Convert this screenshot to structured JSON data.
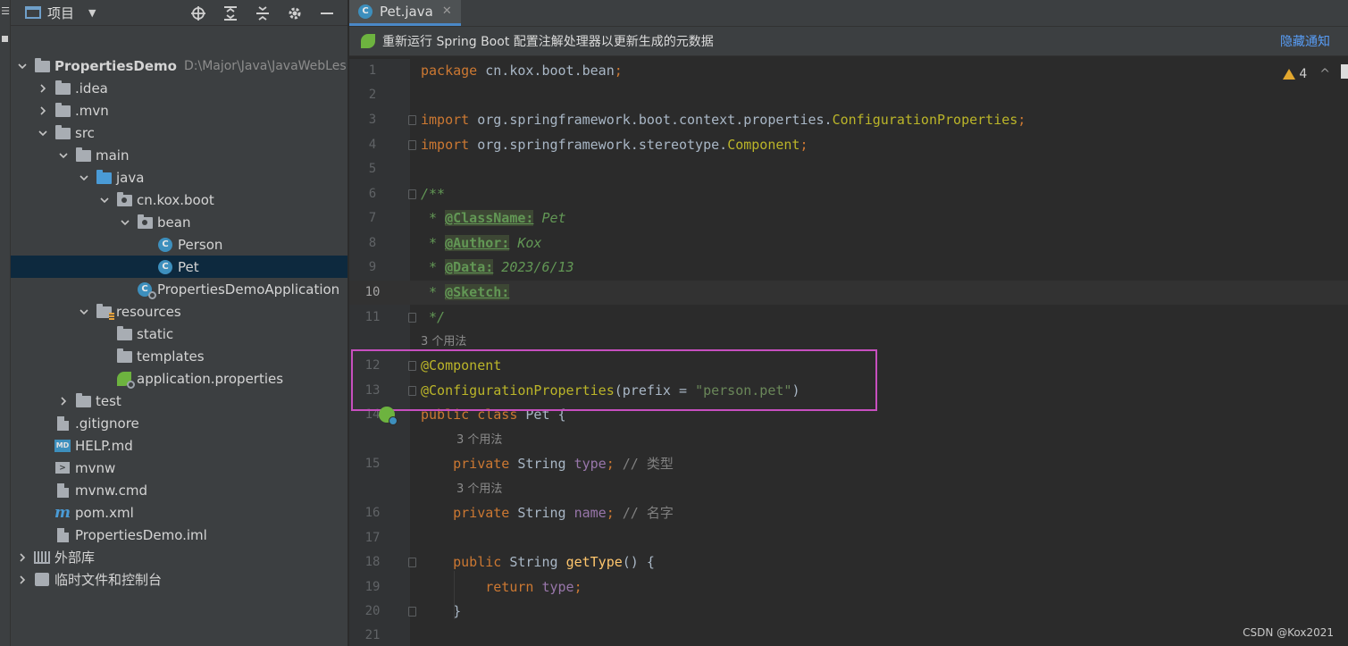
{
  "project_panel": {
    "title": "项目",
    "tree": [
      {
        "label": "PropertiesDemo",
        "path": "D:\\Major\\Java\\JavaWebLes",
        "indent": 0,
        "arrow": "down",
        "icon": "project-folder-icon",
        "bold": true
      },
      {
        "label": ".idea",
        "indent": 1,
        "arrow": "right",
        "icon": "folder-icon"
      },
      {
        "label": ".mvn",
        "indent": 1,
        "arrow": "right",
        "icon": "folder-icon"
      },
      {
        "label": "src",
        "indent": 1,
        "arrow": "down",
        "icon": "folder-icon"
      },
      {
        "label": "main",
        "indent": 2,
        "arrow": "down",
        "icon": "folder-icon"
      },
      {
        "label": "java",
        "indent": 3,
        "arrow": "down",
        "icon": "source-folder-icon"
      },
      {
        "label": "cn.kox.boot",
        "indent": 4,
        "arrow": "down",
        "icon": "package-icon"
      },
      {
        "label": "bean",
        "indent": 5,
        "arrow": "down",
        "icon": "package-icon"
      },
      {
        "label": "Person",
        "indent": 6,
        "arrow": "none",
        "icon": "class-icon"
      },
      {
        "label": "Pet",
        "indent": 6,
        "arrow": "none",
        "icon": "class-icon",
        "selected": true
      },
      {
        "label": "PropertiesDemoApplication",
        "indent": 5,
        "arrow": "none",
        "icon": "spring-boot-app-icon"
      },
      {
        "label": "resources",
        "indent": 3,
        "arrow": "down",
        "icon": "resources-folder-icon"
      },
      {
        "label": "static",
        "indent": 4,
        "arrow": "none",
        "icon": "folder-icon"
      },
      {
        "label": "templates",
        "indent": 4,
        "arrow": "none",
        "icon": "folder-icon"
      },
      {
        "label": "application.properties",
        "indent": 4,
        "arrow": "none",
        "icon": "spring-properties-icon"
      },
      {
        "label": "test",
        "indent": 2,
        "arrow": "right",
        "icon": "folder-icon"
      },
      {
        "label": ".gitignore",
        "indent": 1,
        "arrow": "none",
        "icon": "file-icon"
      },
      {
        "label": "HELP.md",
        "indent": 1,
        "arrow": "none",
        "icon": "markdown-icon"
      },
      {
        "label": "mvnw",
        "indent": 1,
        "arrow": "none",
        "icon": "terminal-icon"
      },
      {
        "label": "mvnw.cmd",
        "indent": 1,
        "arrow": "none",
        "icon": "file-icon"
      },
      {
        "label": "pom.xml",
        "indent": 1,
        "arrow": "none",
        "icon": "maven-icon"
      },
      {
        "label": "PropertiesDemo.iml",
        "indent": 1,
        "arrow": "none",
        "icon": "file-icon"
      },
      {
        "label": "外部库",
        "indent": 0,
        "arrow": "right",
        "icon": "library-icon"
      },
      {
        "label": "临时文件和控制台",
        "indent": 0,
        "arrow": "right",
        "icon": "scratch-icon"
      }
    ]
  },
  "editor": {
    "tab_label": "Pet.java",
    "notice_text": "重新运行 Spring Boot 配置注解处理器以更新生成的元数据",
    "notice_action": "隐藏通知",
    "warning_count": "4",
    "current_line": 10,
    "lines": [
      {
        "n": "1",
        "tokens": [
          [
            "kw",
            "package "
          ],
          [
            "",
            "cn.kox.boot.bean"
          ],
          [
            "kw",
            ";"
          ]
        ]
      },
      {
        "n": "2",
        "tokens": []
      },
      {
        "n": "3",
        "fold": true,
        "tokens": [
          [
            "kw",
            "import "
          ],
          [
            "",
            "org.springframework.boot.context.properties."
          ],
          [
            "cls",
            "ConfigurationProperties"
          ],
          [
            "kw",
            ";"
          ]
        ]
      },
      {
        "n": "4",
        "fold": true,
        "tokens": [
          [
            "kw",
            "import "
          ],
          [
            "",
            "org.springframework.stereotype."
          ],
          [
            "cls",
            "Component"
          ],
          [
            "kw",
            ";"
          ]
        ]
      },
      {
        "n": "5",
        "tokens": []
      },
      {
        "n": "6",
        "fold": true,
        "tokens": [
          [
            "cm",
            "/**"
          ]
        ]
      },
      {
        "n": "7",
        "tokens": [
          [
            "cm",
            " * "
          ],
          [
            "tag",
            "@ClassName:"
          ],
          [
            "cm",
            " Pet"
          ]
        ]
      },
      {
        "n": "8",
        "tokens": [
          [
            "cm",
            " * "
          ],
          [
            "tag",
            "@Author:"
          ],
          [
            "cm",
            " Kox"
          ]
        ]
      },
      {
        "n": "9",
        "tokens": [
          [
            "cm",
            " * "
          ],
          [
            "tag",
            "@Data:"
          ],
          [
            "cm",
            " 2023/6/13"
          ]
        ]
      },
      {
        "n": "10",
        "tokens": [
          [
            "cm",
            " * "
          ],
          [
            "tag",
            "@Sketch:"
          ]
        ]
      },
      {
        "n": "11",
        "fold": true,
        "tokens": [
          [
            "cm",
            " */"
          ]
        ]
      },
      {
        "hint": "3 个用法"
      },
      {
        "n": "12",
        "fold": true,
        "tokens": [
          [
            "ann",
            "@Component"
          ]
        ]
      },
      {
        "n": "13",
        "fold": true,
        "tokens": [
          [
            "ann",
            "@ConfigurationProperties"
          ],
          [
            "",
            "(prefix = "
          ],
          [
            "str",
            "\"person.pet\""
          ],
          [
            "",
            ")"
          ]
        ]
      },
      {
        "n": "14",
        "tokens": [
          [
            "kw",
            "public class "
          ],
          [
            "",
            "Pet {"
          ]
        ]
      },
      {
        "hint": "3 个用法",
        "indent": 1
      },
      {
        "n": "15",
        "tokens": [
          [
            "",
            "    "
          ],
          [
            "kw",
            "private "
          ],
          [
            "",
            "String "
          ],
          [
            "fld",
            "type"
          ],
          [
            "kw",
            ";"
          ],
          [
            "lc",
            " // 类型"
          ]
        ]
      },
      {
        "hint": "3 个用法",
        "indent": 1
      },
      {
        "n": "16",
        "tokens": [
          [
            "",
            "    "
          ],
          [
            "kw",
            "private "
          ],
          [
            "",
            "String "
          ],
          [
            "fld",
            "name"
          ],
          [
            "kw",
            ";"
          ],
          [
            "lc",
            " // 名字"
          ]
        ]
      },
      {
        "n": "17",
        "tokens": []
      },
      {
        "n": "18",
        "fold": true,
        "tokens": [
          [
            "",
            "    "
          ],
          [
            "kw",
            "public "
          ],
          [
            "",
            "String "
          ],
          [
            "fn",
            "getType"
          ],
          [
            "",
            "() {"
          ]
        ]
      },
      {
        "n": "19",
        "tokens": [
          [
            "",
            "        "
          ],
          [
            "kw",
            "return "
          ],
          [
            "fld",
            "type"
          ],
          [
            "kw",
            ";"
          ]
        ]
      },
      {
        "n": "20",
        "fold": true,
        "tokens": [
          [
            "",
            "    }"
          ]
        ]
      },
      {
        "n": "21",
        "tokens": []
      }
    ]
  },
  "watermark": "CSDN @Kox2021"
}
